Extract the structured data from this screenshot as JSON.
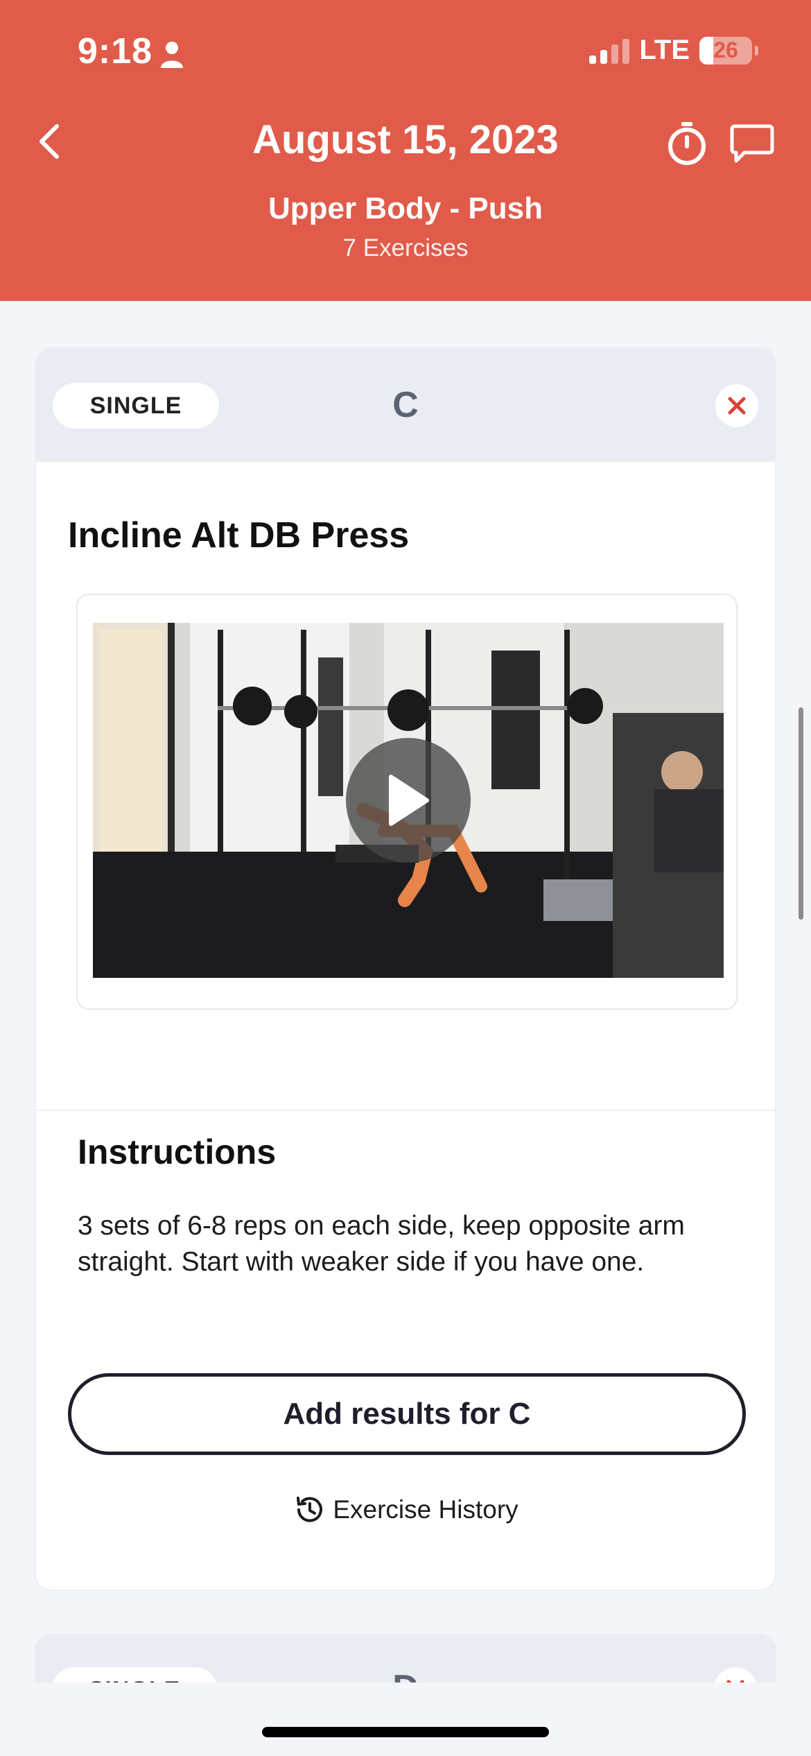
{
  "status_bar": {
    "time": "9:18",
    "network": "LTE",
    "battery": "26"
  },
  "header": {
    "title": "August 15, 2023",
    "subtitle": "Upper Body - Push",
    "exercise_count": "7 Exercises"
  },
  "exercise_card": {
    "type_label": "SINGLE",
    "block_letter": "C",
    "exercise_name": "Incline Alt DB Press",
    "instructions_title": "Instructions",
    "instructions_text": "3 sets of 6-8 reps on each side, keep opposite arm straight. Start with weaker side if you have one.",
    "add_results_label": "Add results for C",
    "history_label": "Exercise History"
  },
  "next_card": {
    "type_label": "SINGLE",
    "block_letter": "D"
  },
  "colors": {
    "header": "#e05b4a",
    "background": "#f4f5f8",
    "card_head": "#e9ecf2",
    "close_x": "#d9433a"
  },
  "icons": [
    "back-chevron-icon",
    "timer-icon",
    "chat-icon",
    "close-icon",
    "play-icon",
    "history-icon",
    "person-icon"
  ]
}
